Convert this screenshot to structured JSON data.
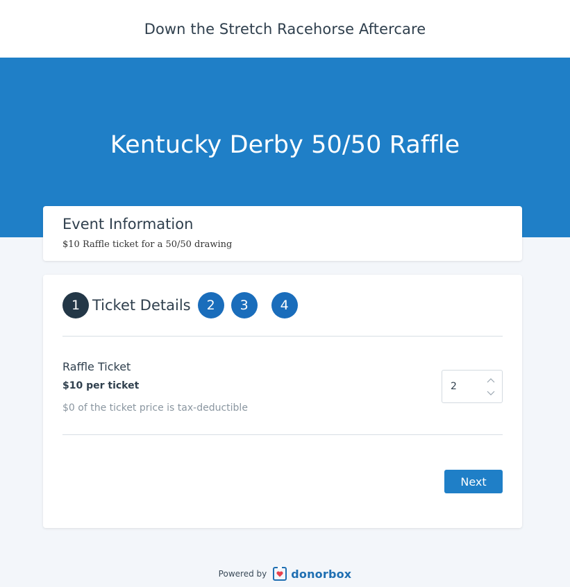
{
  "header": {
    "org_name": "Down the Stretch Racehorse Aftercare"
  },
  "hero": {
    "title": "Kentucky Derby 50/50 Raffle"
  },
  "event_info": {
    "heading": "Event Information",
    "description": "$10 Raffle ticket for a 50/50 drawing"
  },
  "steps": {
    "items": [
      {
        "number": "1",
        "label": "Ticket Details",
        "active": true
      },
      {
        "number": "2"
      },
      {
        "number": "3"
      },
      {
        "number": "4"
      }
    ]
  },
  "ticket": {
    "name": "Raffle Ticket",
    "price": "$10 per ticket",
    "tax_note": "$0 of the ticket price is tax-deductible",
    "quantity": "2"
  },
  "actions": {
    "next_label": "Next"
  },
  "footer": {
    "powered_by": "Powered by",
    "brand": "donorbox"
  },
  "colors": {
    "hero_bg": "#1f7fc7",
    "active_step": "#233747",
    "step": "#1a6dbb",
    "button": "#1f7fc7",
    "brand": "#1f6fb2",
    "brand_heart": "#e8414d"
  },
  "icons": {
    "qty_up": "chevron-up-icon",
    "qty_down": "chevron-down-icon",
    "brand": "donorbox-logo-icon"
  }
}
